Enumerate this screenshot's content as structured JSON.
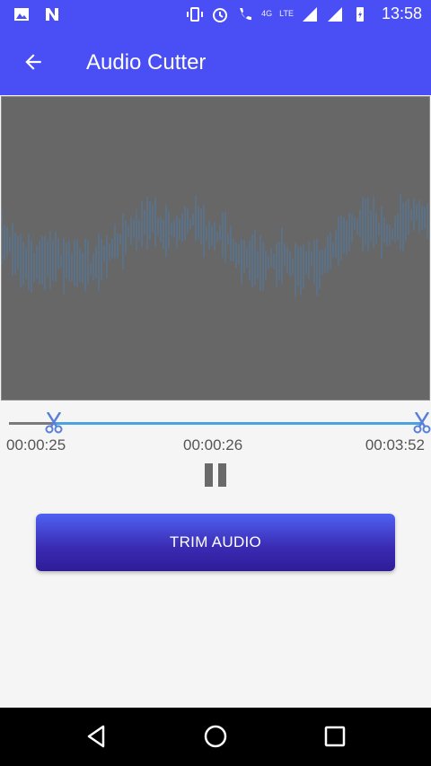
{
  "status_bar": {
    "time": "13:58",
    "network_labels": [
      "4G",
      "LTE"
    ],
    "icons": [
      "image-icon",
      "n-icon",
      "vibrate-icon",
      "alarm-icon",
      "call-icon",
      "signal-icon",
      "signal-icon",
      "battery-icon"
    ]
  },
  "app_bar": {
    "title": "Audio Cutter",
    "back_icon": "back-arrow-icon"
  },
  "waveform": {
    "background": "#676767",
    "wave_color": "#4d7fb0"
  },
  "trim_range": {
    "start_fraction": 0.108,
    "end_fraction": 1.0
  },
  "times": {
    "start": "00:00:25",
    "current": "00:00:26",
    "end": "00:03:52"
  },
  "playback": {
    "state": "playing",
    "button_icon": "pause-icon"
  },
  "trim_button": {
    "label": "TRIM AUDIO"
  },
  "nav_bar": {
    "icons": [
      "back-icon",
      "home-icon",
      "recents-icon"
    ]
  },
  "colors": {
    "accent": "#4a4ff5",
    "seek_active": "#4aa3df",
    "button_dark": "#2e1c97"
  }
}
